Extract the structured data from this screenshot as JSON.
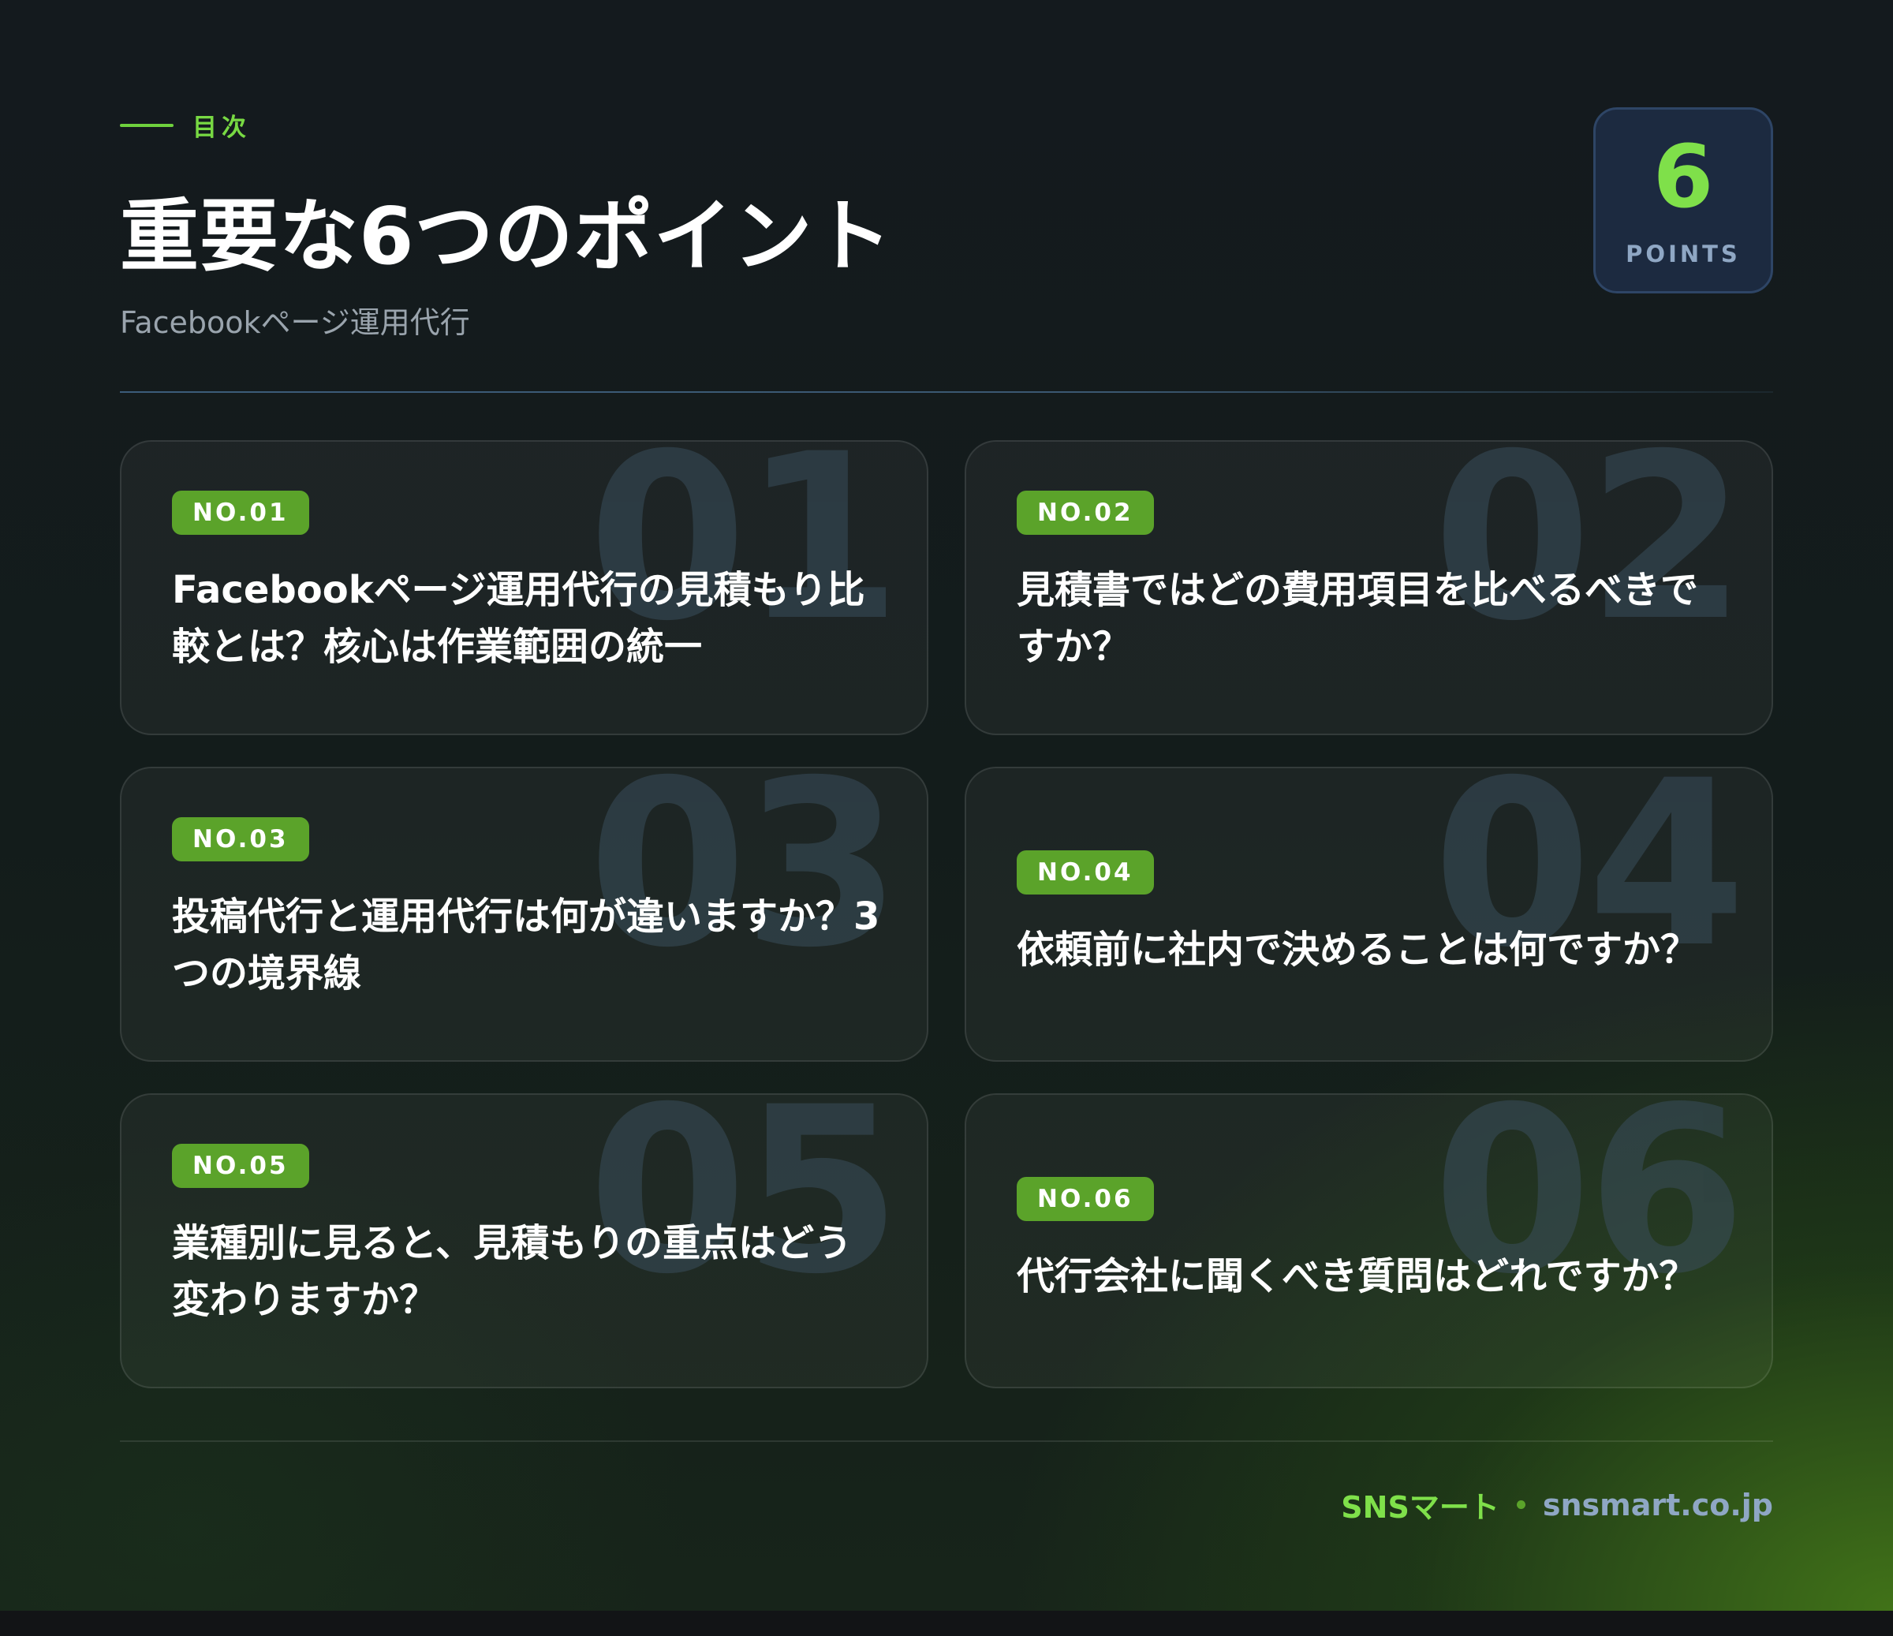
{
  "header": {
    "eyebrow": "目次",
    "title": "重要な6つのポイント",
    "subtitle": "Facebookページ運用代行"
  },
  "badge": {
    "number": "6",
    "label": "POINTS"
  },
  "cards": [
    {
      "bg_number": "01",
      "tag": "NO.01",
      "title": "Facebookページ運用代行の見積もり比較とは？核心は作業範囲の統一"
    },
    {
      "bg_number": "02",
      "tag": "NO.02",
      "title": "見積書ではどの費用項目を比べるべきですか？"
    },
    {
      "bg_number": "03",
      "tag": "NO.03",
      "title": "投稿代行と運用代行は何が違いますか？3つの境界線"
    },
    {
      "bg_number": "04",
      "tag": "NO.04",
      "title": "依頼前に社内で決めることは何ですか？"
    },
    {
      "bg_number": "05",
      "tag": "NO.05",
      "title": "業種別に見ると、見積もりの重点はどう変わりますか？"
    },
    {
      "bg_number": "06",
      "tag": "NO.06",
      "title": "代行会社に聞くべき質問はどれですか？"
    }
  ],
  "footer": {
    "brand": "SNSマート",
    "domain": "snsmart.co.jp"
  },
  "colors": {
    "accent_green": "#7fe04a",
    "tag_green": "#5ba32a",
    "badge_bg": "#1c2a40",
    "muted_blue": "#8fa7c4"
  }
}
